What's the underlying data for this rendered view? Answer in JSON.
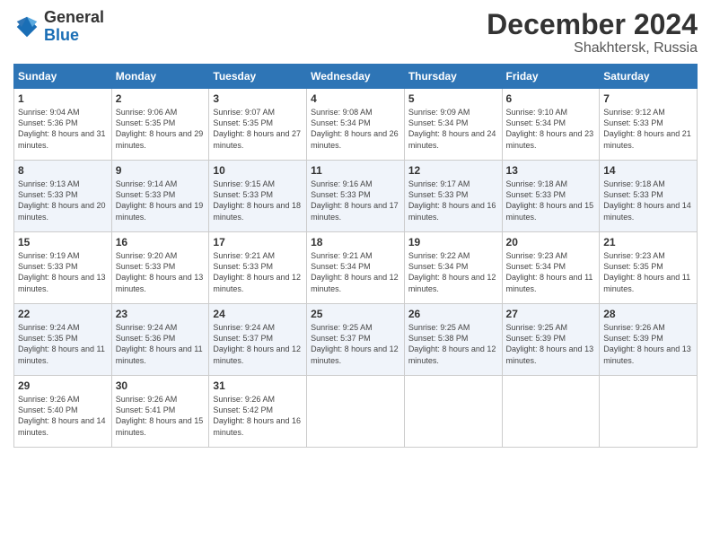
{
  "header": {
    "logo_general": "General",
    "logo_blue": "Blue",
    "month_title": "December 2024",
    "subtitle": "Shakhtersk, Russia"
  },
  "weekdays": [
    "Sunday",
    "Monday",
    "Tuesday",
    "Wednesday",
    "Thursday",
    "Friday",
    "Saturday"
  ],
  "weeks": [
    [
      {
        "day": "1",
        "sunrise": "Sunrise: 9:04 AM",
        "sunset": "Sunset: 5:36 PM",
        "daylight": "Daylight: 8 hours and 31 minutes."
      },
      {
        "day": "2",
        "sunrise": "Sunrise: 9:06 AM",
        "sunset": "Sunset: 5:35 PM",
        "daylight": "Daylight: 8 hours and 29 minutes."
      },
      {
        "day": "3",
        "sunrise": "Sunrise: 9:07 AM",
        "sunset": "Sunset: 5:35 PM",
        "daylight": "Daylight: 8 hours and 27 minutes."
      },
      {
        "day": "4",
        "sunrise": "Sunrise: 9:08 AM",
        "sunset": "Sunset: 5:34 PM",
        "daylight": "Daylight: 8 hours and 26 minutes."
      },
      {
        "day": "5",
        "sunrise": "Sunrise: 9:09 AM",
        "sunset": "Sunset: 5:34 PM",
        "daylight": "Daylight: 8 hours and 24 minutes."
      },
      {
        "day": "6",
        "sunrise": "Sunrise: 9:10 AM",
        "sunset": "Sunset: 5:34 PM",
        "daylight": "Daylight: 8 hours and 23 minutes."
      },
      {
        "day": "7",
        "sunrise": "Sunrise: 9:12 AM",
        "sunset": "Sunset: 5:33 PM",
        "daylight": "Daylight: 8 hours and 21 minutes."
      }
    ],
    [
      {
        "day": "8",
        "sunrise": "Sunrise: 9:13 AM",
        "sunset": "Sunset: 5:33 PM",
        "daylight": "Daylight: 8 hours and 20 minutes."
      },
      {
        "day": "9",
        "sunrise": "Sunrise: 9:14 AM",
        "sunset": "Sunset: 5:33 PM",
        "daylight": "Daylight: 8 hours and 19 minutes."
      },
      {
        "day": "10",
        "sunrise": "Sunrise: 9:15 AM",
        "sunset": "Sunset: 5:33 PM",
        "daylight": "Daylight: 8 hours and 18 minutes."
      },
      {
        "day": "11",
        "sunrise": "Sunrise: 9:16 AM",
        "sunset": "Sunset: 5:33 PM",
        "daylight": "Daylight: 8 hours and 17 minutes."
      },
      {
        "day": "12",
        "sunrise": "Sunrise: 9:17 AM",
        "sunset": "Sunset: 5:33 PM",
        "daylight": "Daylight: 8 hours and 16 minutes."
      },
      {
        "day": "13",
        "sunrise": "Sunrise: 9:18 AM",
        "sunset": "Sunset: 5:33 PM",
        "daylight": "Daylight: 8 hours and 15 minutes."
      },
      {
        "day": "14",
        "sunrise": "Sunrise: 9:18 AM",
        "sunset": "Sunset: 5:33 PM",
        "daylight": "Daylight: 8 hours and 14 minutes."
      }
    ],
    [
      {
        "day": "15",
        "sunrise": "Sunrise: 9:19 AM",
        "sunset": "Sunset: 5:33 PM",
        "daylight": "Daylight: 8 hours and 13 minutes."
      },
      {
        "day": "16",
        "sunrise": "Sunrise: 9:20 AM",
        "sunset": "Sunset: 5:33 PM",
        "daylight": "Daylight: 8 hours and 13 minutes."
      },
      {
        "day": "17",
        "sunrise": "Sunrise: 9:21 AM",
        "sunset": "Sunset: 5:33 PM",
        "daylight": "Daylight: 8 hours and 12 minutes."
      },
      {
        "day": "18",
        "sunrise": "Sunrise: 9:21 AM",
        "sunset": "Sunset: 5:34 PM",
        "daylight": "Daylight: 8 hours and 12 minutes."
      },
      {
        "day": "19",
        "sunrise": "Sunrise: 9:22 AM",
        "sunset": "Sunset: 5:34 PM",
        "daylight": "Daylight: 8 hours and 12 minutes."
      },
      {
        "day": "20",
        "sunrise": "Sunrise: 9:23 AM",
        "sunset": "Sunset: 5:34 PM",
        "daylight": "Daylight: 8 hours and 11 minutes."
      },
      {
        "day": "21",
        "sunrise": "Sunrise: 9:23 AM",
        "sunset": "Sunset: 5:35 PM",
        "daylight": "Daylight: 8 hours and 11 minutes."
      }
    ],
    [
      {
        "day": "22",
        "sunrise": "Sunrise: 9:24 AM",
        "sunset": "Sunset: 5:35 PM",
        "daylight": "Daylight: 8 hours and 11 minutes."
      },
      {
        "day": "23",
        "sunrise": "Sunrise: 9:24 AM",
        "sunset": "Sunset: 5:36 PM",
        "daylight": "Daylight: 8 hours and 11 minutes."
      },
      {
        "day": "24",
        "sunrise": "Sunrise: 9:24 AM",
        "sunset": "Sunset: 5:37 PM",
        "daylight": "Daylight: 8 hours and 12 minutes."
      },
      {
        "day": "25",
        "sunrise": "Sunrise: 9:25 AM",
        "sunset": "Sunset: 5:37 PM",
        "daylight": "Daylight: 8 hours and 12 minutes."
      },
      {
        "day": "26",
        "sunrise": "Sunrise: 9:25 AM",
        "sunset": "Sunset: 5:38 PM",
        "daylight": "Daylight: 8 hours and 12 minutes."
      },
      {
        "day": "27",
        "sunrise": "Sunrise: 9:25 AM",
        "sunset": "Sunset: 5:39 PM",
        "daylight": "Daylight: 8 hours and 13 minutes."
      },
      {
        "day": "28",
        "sunrise": "Sunrise: 9:26 AM",
        "sunset": "Sunset: 5:39 PM",
        "daylight": "Daylight: 8 hours and 13 minutes."
      }
    ],
    [
      {
        "day": "29",
        "sunrise": "Sunrise: 9:26 AM",
        "sunset": "Sunset: 5:40 PM",
        "daylight": "Daylight: 8 hours and 14 minutes."
      },
      {
        "day": "30",
        "sunrise": "Sunrise: 9:26 AM",
        "sunset": "Sunset: 5:41 PM",
        "daylight": "Daylight: 8 hours and 15 minutes."
      },
      {
        "day": "31",
        "sunrise": "Sunrise: 9:26 AM",
        "sunset": "Sunset: 5:42 PM",
        "daylight": "Daylight: 8 hours and 16 minutes."
      },
      null,
      null,
      null,
      null
    ]
  ]
}
